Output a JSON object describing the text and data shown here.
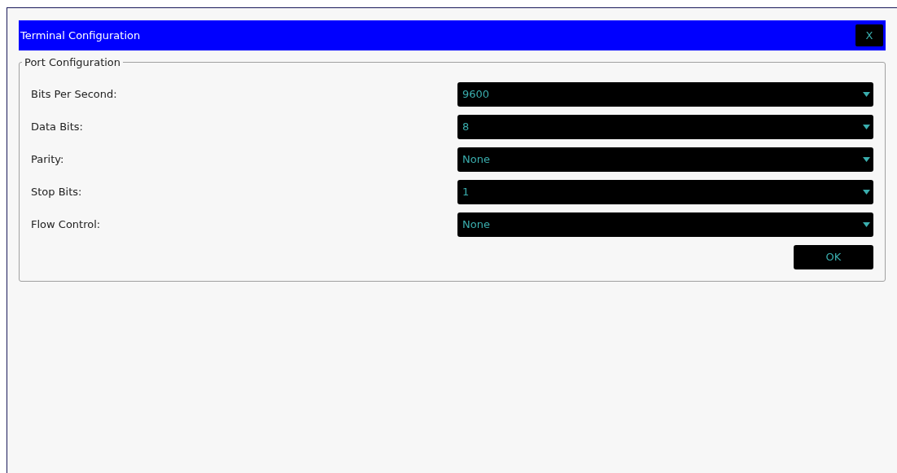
{
  "window": {
    "title": "Terminal Configuration",
    "close": "X"
  },
  "group": {
    "title": "Port Configuration",
    "fields": [
      {
        "label": "Bits Per Second:",
        "value": "9600"
      },
      {
        "label": "Data Bits:",
        "value": "8"
      },
      {
        "label": "Parity:",
        "value": "None"
      },
      {
        "label": "Stop Bits:",
        "value": "1"
      },
      {
        "label": "Flow Control:",
        "value": "None"
      }
    ],
    "button": "OK"
  }
}
